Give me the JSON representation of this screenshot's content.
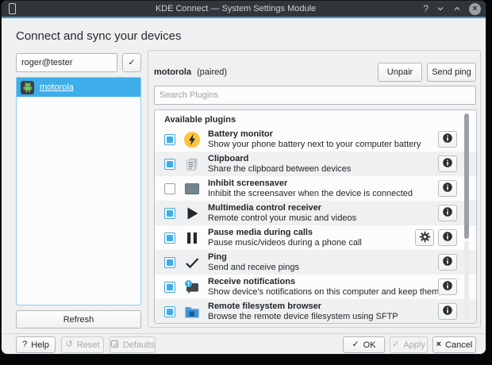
{
  "titlebar": {
    "title": "KDE Connect — System Settings Module",
    "help_symbol": "?",
    "close_symbol": "×"
  },
  "header": {
    "title": "Connect and sync your devices"
  },
  "sidebar": {
    "device_id": "roger@tester",
    "accept_symbol": "✓",
    "devices": [
      {
        "name": "motorola",
        "selected": true
      }
    ],
    "refresh_label": "Refresh"
  },
  "detail": {
    "device_name": "motorola",
    "device_status": "(paired)",
    "unpair_label": "Unpair",
    "send_ping_label": "Send ping",
    "search_placeholder": "Search Plugins",
    "plugins_header": "Available plugins",
    "plugins": [
      {
        "title": "Battery monitor",
        "description": "Show your phone battery next to your computer battery",
        "checked": true,
        "icon": "battery-icon",
        "has_settings": false
      },
      {
        "title": "Clipboard",
        "description": "Share the clipboard between devices",
        "checked": true,
        "icon": "clipboard-icon",
        "has_settings": false
      },
      {
        "title": "Inhibit screensaver",
        "description": "Inhibit the screensaver when the device is connected",
        "checked": false,
        "icon": "screensaver-icon",
        "has_settings": false
      },
      {
        "title": "Multimedia control receiver",
        "description": "Remote control your music and videos",
        "checked": true,
        "icon": "play-icon",
        "has_settings": false
      },
      {
        "title": "Pause media during calls",
        "description": "Pause music/videos during a phone call",
        "checked": true,
        "icon": "pause-icon",
        "has_settings": true
      },
      {
        "title": "Ping",
        "description": "Send and receive pings",
        "checked": true,
        "icon": "check-icon",
        "has_settings": false
      },
      {
        "title": "Receive notifications",
        "description": "Show device's notifications on this computer and keep them in sync",
        "checked": true,
        "icon": "notification-icon",
        "has_settings": false
      },
      {
        "title": "Remote filesystem browser",
        "description": "Browse the remote device filesystem using SFTP",
        "checked": true,
        "icon": "folder-icon",
        "has_settings": false
      }
    ]
  },
  "footer": {
    "help_label": "Help",
    "reset_label": "Reset",
    "defaults_label": "Defaults",
    "ok_label": "OK",
    "apply_label": "Apply",
    "cancel_label": "Cancel"
  },
  "colors": {
    "accent": "#3daee9",
    "titlebar_bg": "#31363b",
    "window_bg": "#eff0f1",
    "selection_text": "#ffffff"
  }
}
